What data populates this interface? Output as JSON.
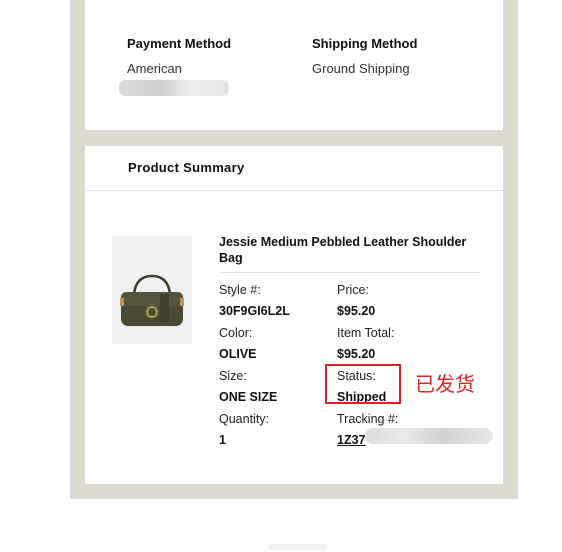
{
  "order_info": {
    "payment_method_label": "Payment Method",
    "payment_method_value": "American",
    "shipping_method_label": "Shipping Method",
    "shipping_method_value": "Ground Shipping"
  },
  "product_summary": {
    "title": "Product Summary",
    "product": {
      "name": "Jessie Medium Pebbled Leather Shoulder Bag",
      "style_label": "Style #:",
      "style_value": "30F9GI6L2L",
      "price_label": "Price:",
      "price_value": "$95.20",
      "color_label": "Color:",
      "color_value": "OLIVE",
      "item_total_label": "Item Total:",
      "item_total_value": "$95.20",
      "size_label": "Size:",
      "size_value": "ONE SIZE",
      "status_label": "Status:",
      "status_value": "Shipped",
      "quantity_label": "Quantity:",
      "quantity_value": "1",
      "tracking_label": "Tracking #:",
      "tracking_value": "1Z37"
    }
  },
  "annotation": {
    "text": "已发货",
    "color": "#e0262a"
  },
  "colors": {
    "background_frame": "#dddad4",
    "card": "#ffffff",
    "bag_olive": "#4a4a32"
  }
}
